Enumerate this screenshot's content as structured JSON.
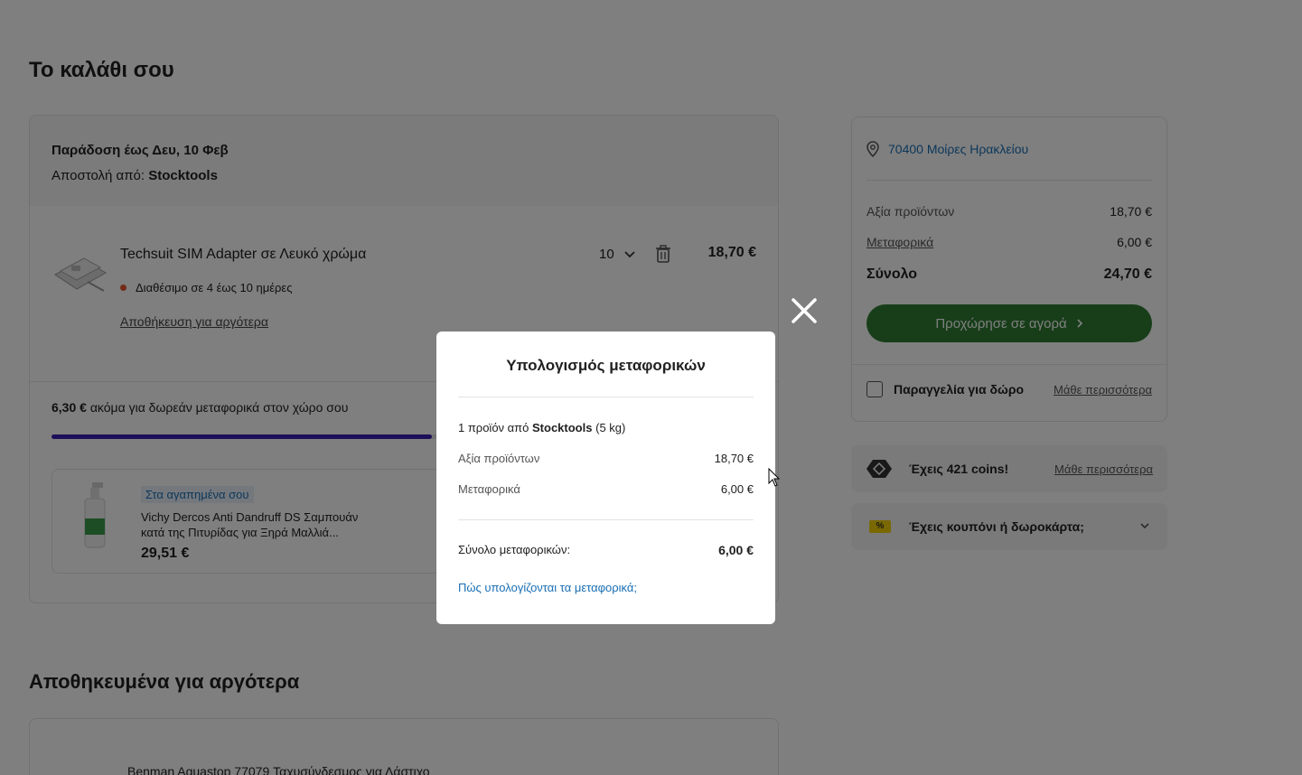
{
  "page": {
    "title": "Το καλάθι σου"
  },
  "cart": {
    "delivery": "Παράδοση έως Δευ, 10 Φεβ",
    "shipper_prefix": "Αποστολή από:",
    "shipper_name": "Stocktools",
    "item": {
      "title": "Techsuit SIM Adapter σε Λευκό χρώμα",
      "availability": "Διαθέσιμο σε 4 έως 10 ημέρες",
      "save_later": "Αποθήκευση για αργότερα",
      "quantity": "10",
      "price": "18,70 €"
    },
    "free_shipping": {
      "amount": "6,30 €",
      "text": "ακόμα για δωρεάν μεταφορικά στον χώρο σου",
      "progress": 0.54
    },
    "favorite": {
      "tag": "Στα αγαπημένα σου",
      "name": "Vichy Dercos Anti Dandruff DS Σαμπουάν κατά της Πιτυρίδας για Ξηρά Μαλλιά...",
      "price": "29,51 €"
    }
  },
  "saved": {
    "title": "Αποθηκευμένα για αργότερα",
    "item": "Benman Aquastop 77079 Ταχυσύνδεσμος για Λάστιχο"
  },
  "summary": {
    "location": "70400 Μοίρες Ηρακλείου",
    "products_label": "Αξία προϊόντων",
    "products_value": "18,70 €",
    "shipping_label": "Μεταφορικά",
    "shipping_value": "6,00 €",
    "total_label": "Σύνολο",
    "total_value": "24,70 €",
    "checkout": "Προχώρησε σε αγορά",
    "gift_label": "Παραγγελία για δώρο",
    "gift_more": "Μάθε περισσότερα"
  },
  "coins": {
    "text": "Έχεις 421 coins!",
    "more": "Μάθε περισσότερα"
  },
  "coupon": {
    "icon_text": "%",
    "text": "Έχεις κουπόνι ή δωροκάρτα;"
  },
  "modal": {
    "title": "Υπολογισμός μεταφορικών",
    "line_prefix": "1 προϊόν από",
    "line_shop": "Stocktools",
    "line_weight": "(5 kg)",
    "products_label": "Αξία προϊόντων",
    "products_value": "18,70 €",
    "shipping_label": "Μεταφορικά",
    "shipping_value": "6,00 €",
    "total_label": "Σύνολο μεταφορικών:",
    "total_value": "6,00 €",
    "help_link": "Πώς υπολογίζονται τα μεταφορικά;"
  },
  "colors": {
    "accent_green": "#2f7d32",
    "link_blue": "#1a6fb4",
    "progress_purple": "#3d1fb5",
    "availability_orange": "#e4572e",
    "overlay": "rgba(0,0,0,0.5)"
  }
}
